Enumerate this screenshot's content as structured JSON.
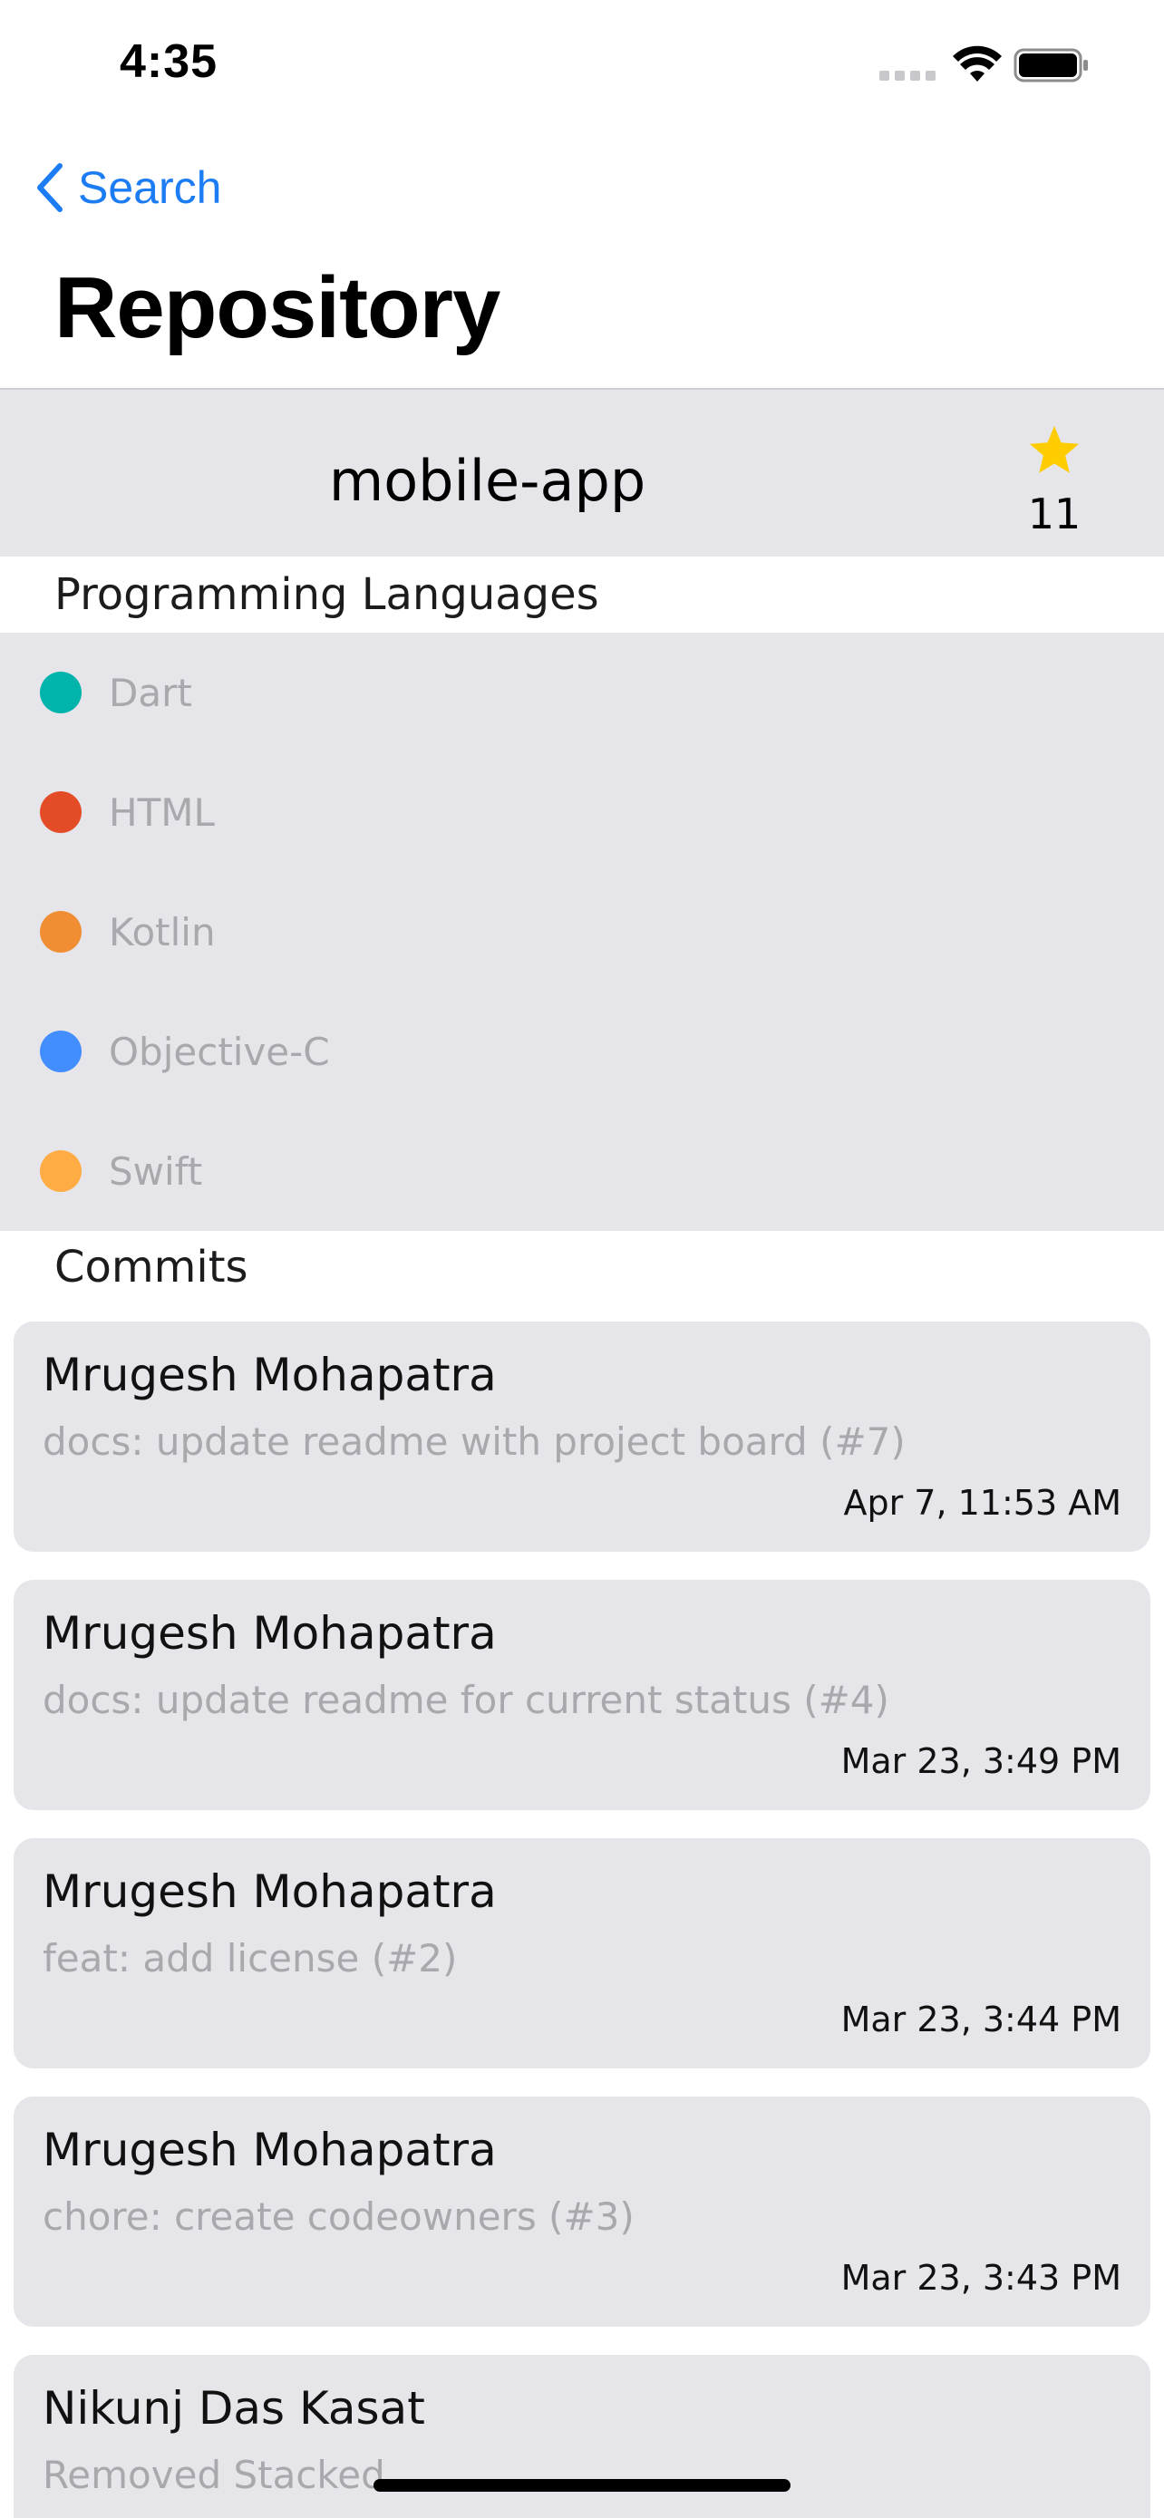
{
  "status_bar": {
    "time": "4:35"
  },
  "nav": {
    "back_label": "Search",
    "title": "Repository"
  },
  "repo": {
    "name": "mobile-app",
    "stars": "11",
    "star_color": "#ffcc00"
  },
  "sections": {
    "languages": "Programming Languages",
    "commits": "Commits"
  },
  "languages": [
    {
      "name": "Dart",
      "color": "#00b4ab"
    },
    {
      "name": "HTML",
      "color": "#e34c26"
    },
    {
      "name": "Kotlin",
      "color": "#f18e33"
    },
    {
      "name": "Objective-C",
      "color": "#438eff"
    },
    {
      "name": "Swift",
      "color": "#ffac45"
    }
  ],
  "commits": [
    {
      "author": "Mrugesh Mohapatra",
      "message": "docs: update readme with project board (#7)",
      "date": "Apr 7, 11:53 AM"
    },
    {
      "author": "Mrugesh Mohapatra",
      "message": "docs: update readme for current status (#4)",
      "date": "Mar 23, 3:49 PM"
    },
    {
      "author": "Mrugesh Mohapatra",
      "message": "feat: add license (#2)",
      "date": "Mar 23, 3:44 PM"
    },
    {
      "author": "Mrugesh Mohapatra",
      "message": "chore: create codeowners (#3)",
      "date": "Mar 23, 3:43 PM"
    },
    {
      "author": "Nikunj Das Kasat",
      "message": "Removed Stacked",
      "date": ""
    }
  ],
  "accent_color": "#1c7cf4"
}
